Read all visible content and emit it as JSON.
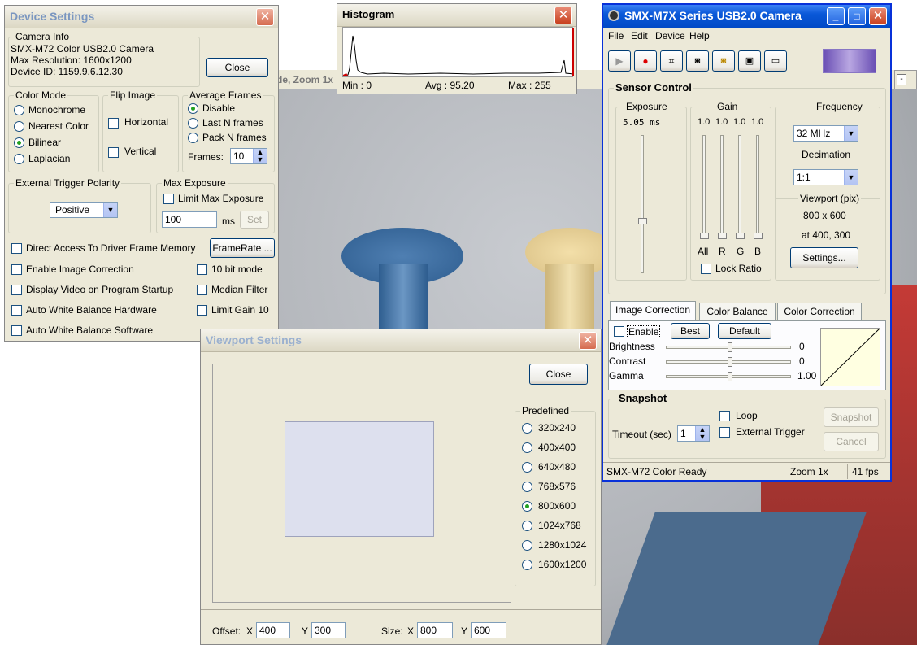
{
  "video_bg": {
    "partial_title": "de, Zoom 1x"
  },
  "device_settings": {
    "title": "Device Settings",
    "camera_info": {
      "label": "Camera Info",
      "line1": "SMX-M72 Color USB2.0 Camera",
      "line2": "Max Resolution: 1600x1200",
      "line3": "Device ID: 1159.9.6.12.30"
    },
    "close_label": "Close",
    "color_mode": {
      "label": "Color Mode",
      "options": [
        "Monochrome",
        "Nearest Color",
        "Bilinear",
        "Laplacian"
      ],
      "selected": "Bilinear"
    },
    "flip_image": {
      "label": "Flip Image",
      "horizontal": "Horizontal",
      "vertical": "Vertical"
    },
    "average_frames": {
      "label": "Average Frames",
      "options": [
        "Disable",
        "Last N frames",
        "Pack N frames"
      ],
      "frames_label": "Frames:",
      "frames_value": "10"
    },
    "trigger": {
      "label": "External Trigger Polarity",
      "value": "Positive"
    },
    "max_exposure": {
      "label": "Max Exposure",
      "limit_label": "Limit Max Exposure",
      "value": "100",
      "unit": "ms",
      "set_label": "Set"
    },
    "checks": {
      "direct_access": "Direct Access To Driver Frame Memory",
      "framerate_button": "FrameRate ...",
      "image_correction": "Enable Image Correction",
      "ten_bit": "10 bit mode",
      "display_video": "Display Video on Program Startup",
      "median_filter": "Median Filter",
      "awb_hw": "Auto White Balance Hardware",
      "limit_gain": "Limit Gain 10",
      "awb_sw": "Auto White Balance Software"
    }
  },
  "histogram": {
    "title": "Histogram",
    "min": "Min : 0",
    "avg": "Avg : 95.20",
    "max": "Max : 255"
  },
  "camera_window": {
    "title": "SMX-M7X Series USB2.0 Camera",
    "menu": [
      "File",
      "Edit",
      "Device",
      "Help"
    ],
    "sensor_control": "Sensor Control",
    "exposure": {
      "label": "Exposure",
      "value": "5.05 ms"
    },
    "gain": {
      "label": "Gain",
      "values": [
        "1.0",
        "1.0",
        "1.0",
        "1.0"
      ],
      "channels": [
        "All",
        "R",
        "G",
        "B"
      ],
      "lock_ratio": "Lock Ratio"
    },
    "frequency": {
      "label": "Frequency",
      "value": "32 MHz"
    },
    "decimation": {
      "label": "Decimation",
      "value": "1:1"
    },
    "viewport": {
      "label": "Viewport (pix)",
      "size": "800 x 600",
      "pos": "at 400, 300",
      "settings_label": "Settings..."
    },
    "tabs": [
      "Image Correction",
      "Color Balance",
      "Color Correction"
    ],
    "image_correction": {
      "enable": "Enable",
      "best": "Best",
      "default": "Default",
      "brightness": "Brightness",
      "brightness_val": "0",
      "contrast": "Contrast",
      "contrast_val": "0",
      "gamma": "Gamma",
      "gamma_val": "1.00"
    },
    "snapshot": {
      "label": "Snapshot",
      "loop": "Loop",
      "timeout_label": "Timeout (sec)",
      "timeout_value": "1",
      "external_trigger": "External Trigger",
      "snapshot_btn": "Snapshot",
      "cancel_btn": "Cancel"
    },
    "status": {
      "text": "SMX-M72 Color Ready",
      "zoom": "Zoom 1x",
      "fps": "41 fps"
    }
  },
  "viewport_settings": {
    "title": "Viewport Settings",
    "close_label": "Close",
    "predefined_label": "Predefined",
    "options": [
      "320x240",
      "400x400",
      "640x480",
      "768x576",
      "800x600",
      "1024x768",
      "1280x1024",
      "1600x1200"
    ],
    "selected": "800x600",
    "offset_label": "Offset:",
    "x_label": "X",
    "y_label": "Y",
    "offset_x": "400",
    "offset_y": "300",
    "size_label": "Size:",
    "size_x": "800",
    "size_y": "600"
  },
  "colors": {
    "xp_blue": "#0a58d8",
    "dialog_bg": "#ece9d8",
    "video_gray": "#b9bcc0"
  }
}
